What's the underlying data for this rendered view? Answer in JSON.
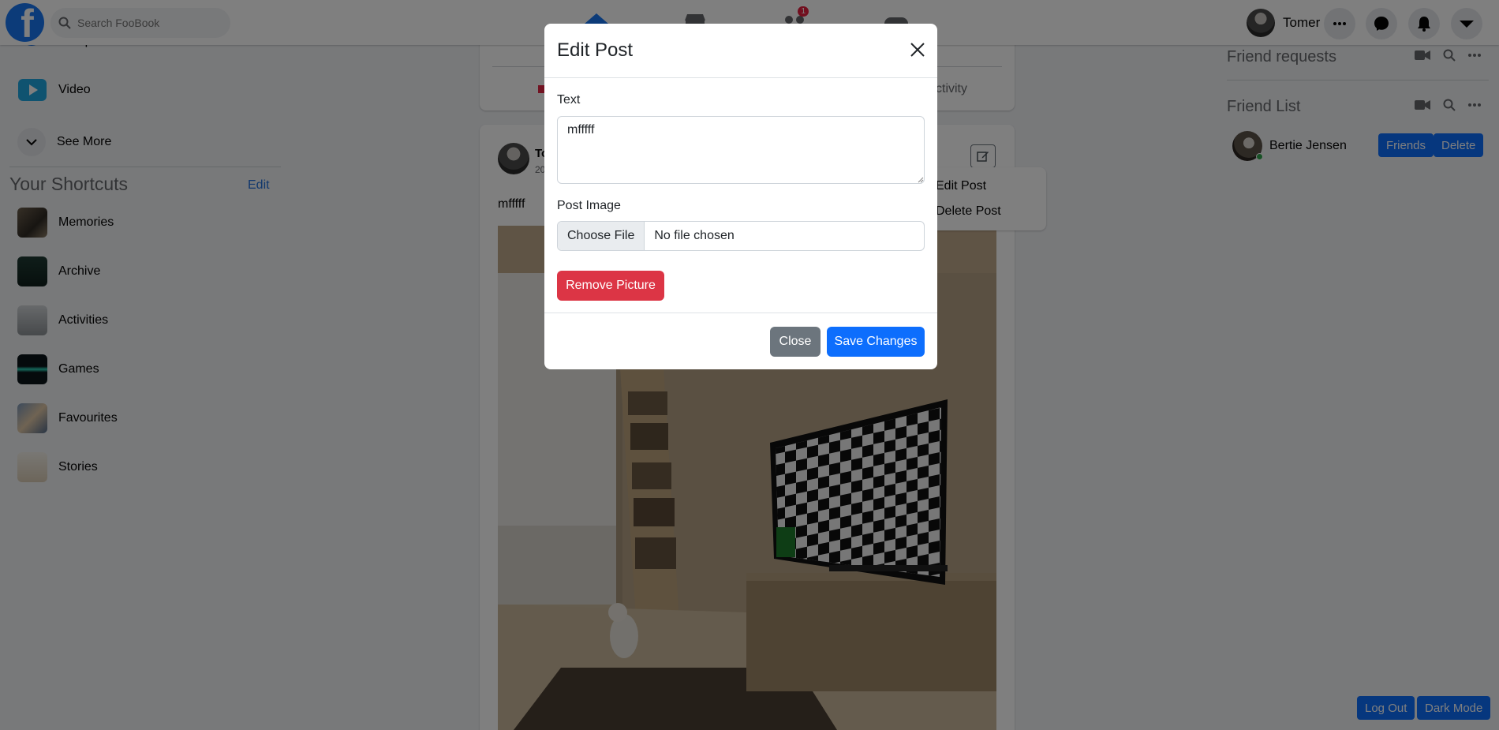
{
  "topbar": {
    "logo_letter": "f",
    "search_placeholder": "Search FooBook",
    "friends_badge": "1",
    "profile_name": "Tomer"
  },
  "left_nav": {
    "items": [
      {
        "label": "Groups"
      },
      {
        "label": "Video"
      },
      {
        "label": "See More"
      }
    ],
    "shortcuts_title": "Your Shortcuts",
    "shortcuts_edit": "Edit",
    "shortcuts": [
      {
        "label": "Memories"
      },
      {
        "label": "Archive"
      },
      {
        "label": "Activities"
      },
      {
        "label": "Games"
      },
      {
        "label": "Favourites"
      },
      {
        "label": "Stories"
      }
    ]
  },
  "feed": {
    "composer_tail_text": "ctivity",
    "post": {
      "author_partial": "To",
      "date_partial": "20",
      "text": "mfffff",
      "menu": [
        "Edit Post",
        "Delete Post"
      ]
    }
  },
  "right_sidebar": {
    "friend_requests_title": "Friend requests",
    "friend_list_title": "Friend List",
    "friends": [
      {
        "name": "Bertie Jensen",
        "status_button": "Friends",
        "delete_button": "Delete"
      }
    ],
    "logout_label": "Log Out",
    "darkmode_label": "Dark Mode"
  },
  "modal": {
    "title": "Edit Post",
    "text_label": "Text",
    "text_value": "mfffff",
    "image_label": "Post Image",
    "choose_file_label": "Choose File",
    "no_file_text": "No file chosen",
    "remove_picture_label": "Remove Picture",
    "close_label": "Close",
    "save_label": "Save Changes"
  },
  "colors": {
    "brand_blue": "#1877f2",
    "primary": "#0d6efd",
    "danger": "#dc3545",
    "secondary": "#6c757d"
  }
}
